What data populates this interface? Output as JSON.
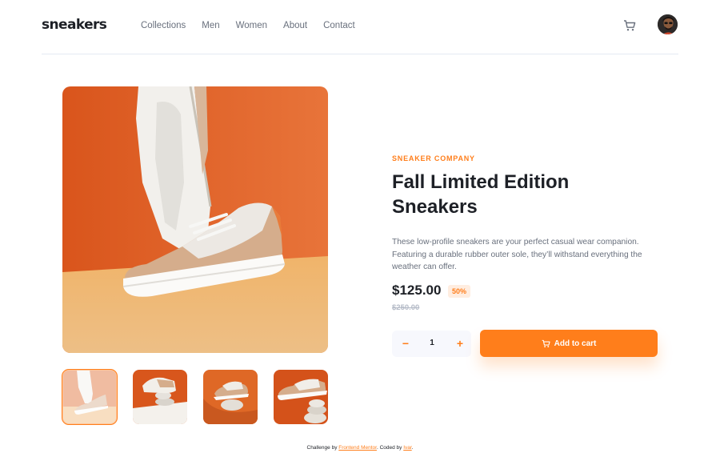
{
  "header": {
    "logo": "sneakers",
    "nav": [
      "Collections",
      "Men",
      "Women",
      "About",
      "Contact"
    ]
  },
  "product": {
    "company": "SNEAKER COMPANY",
    "title_line1": "Fall Limited Edition",
    "title_line2": "Sneakers",
    "description": "These low-profile sneakers are your perfect casual wear companion. Featuring a durable rubber outer sole, they’ll withstand everything the weather can offer.",
    "price": "$125.00",
    "discount": "50%",
    "old_price": "$250.00",
    "quantity": "1",
    "minus_label": "−",
    "plus_label": "+",
    "add_to_cart": "Add to cart"
  },
  "footer": {
    "prefix": "Challenge by ",
    "link1": "Frontend Mentor",
    "middle": ". Coded by ",
    "link2": "Ivar",
    "suffix": "."
  },
  "colors": {
    "accent": "#ff7e1b",
    "accent_pale": "#ffede0",
    "dark": "#1d2026",
    "gray": "#69707d"
  },
  "icons": [
    "cart-icon",
    "avatar",
    "add-to-cart-cart-icon"
  ]
}
